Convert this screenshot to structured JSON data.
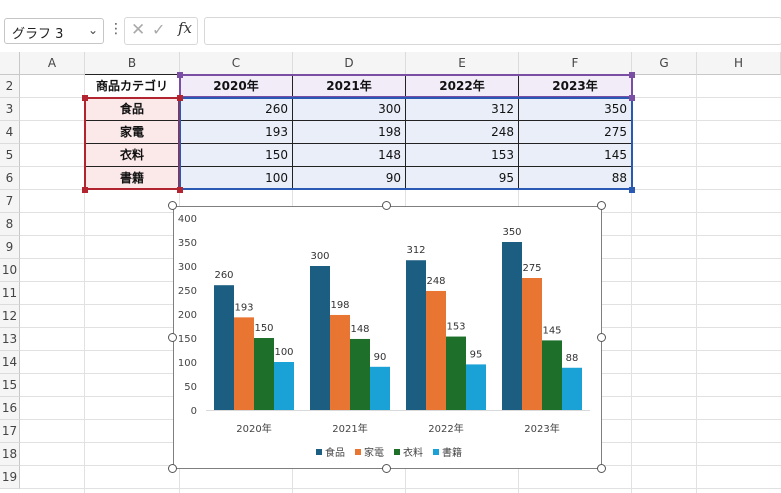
{
  "formula_bar": {
    "name_box": "グラフ 3",
    "fx_label": "fx",
    "cancel_glyph": "✕",
    "enter_glyph": "✓",
    "formula_value": ""
  },
  "columns": [
    "A",
    "B",
    "C",
    "D",
    "E",
    "F",
    "G",
    "H"
  ],
  "rows": [
    "2",
    "3",
    "4",
    "5",
    "6",
    "7",
    "8",
    "9",
    "10",
    "11",
    "12",
    "13",
    "14",
    "15",
    "16",
    "17",
    "18",
    "19"
  ],
  "table": {
    "header": [
      "商品カテゴリ",
      "2020年",
      "2021年",
      "2022年",
      "2023年"
    ],
    "rows": [
      {
        "category": "食品",
        "values": [
          "260",
          "300",
          "312",
          "350"
        ]
      },
      {
        "category": "家電",
        "values": [
          "193",
          "198",
          "248",
          "275"
        ]
      },
      {
        "category": "衣料",
        "values": [
          "150",
          "148",
          "153",
          "145"
        ]
      },
      {
        "category": "書籍",
        "values": [
          "100",
          "90",
          "95",
          "88"
        ]
      }
    ]
  },
  "colors": {
    "series": [
      "#1b5e82",
      "#e97532",
      "#1d6f2a",
      "#1aa2d6"
    ],
    "header_fill": "#f1ecf7",
    "cat_fill": "#fbe9ea",
    "num_fill": "#e9eef8",
    "purple_border": "#7a4ea3",
    "red_border": "#b2242f",
    "blue_border": "#2a59b3"
  },
  "chart_data": {
    "type": "bar",
    "categories": [
      "2020年",
      "2021年",
      "2022年",
      "2023年"
    ],
    "series": [
      {
        "name": "食品",
        "values": [
          260,
          300,
          312,
          350
        ]
      },
      {
        "name": "家電",
        "values": [
          193,
          198,
          248,
          275
        ]
      },
      {
        "name": "衣料",
        "values": [
          150,
          148,
          153,
          145
        ]
      },
      {
        "name": "書籍",
        "values": [
          100,
          90,
          95,
          88
        ]
      }
    ],
    "ylim": [
      0,
      400
    ],
    "yticks": [
      0,
      50,
      100,
      150,
      200,
      250,
      300,
      350,
      400
    ],
    "grid": false,
    "legend": "bottom",
    "data_labels": true
  }
}
